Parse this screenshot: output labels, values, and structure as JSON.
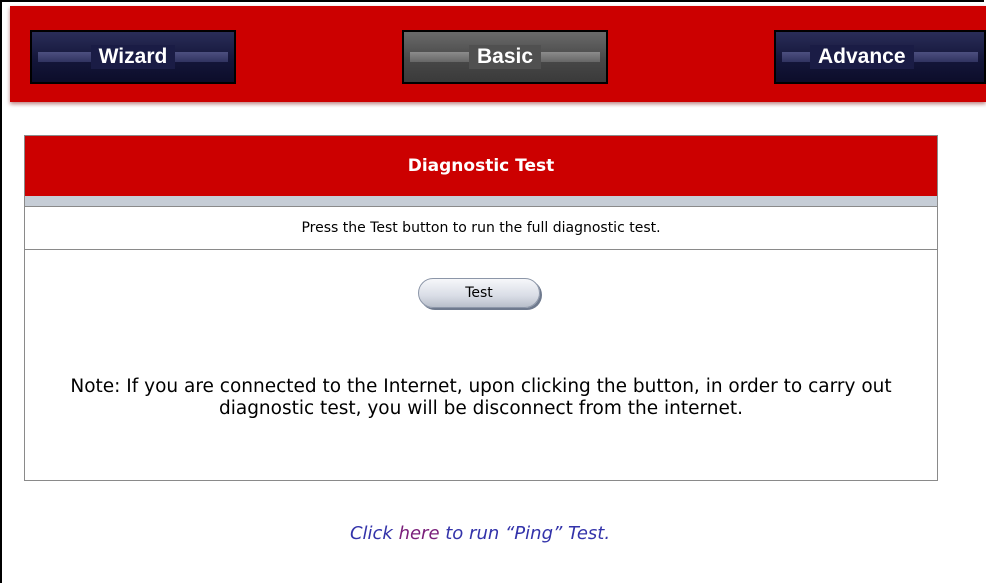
{
  "nav": {
    "wizard_label": "Wizard",
    "basic_label": "Basic",
    "advance_label": "Advance"
  },
  "panel": {
    "title": "Diagnostic Test",
    "instruction": "Press the Test button to run the full diagnostic test.",
    "test_button_label": "Test",
    "note": "Note: If you are connected to the Internet, upon clicking the button, in order to carry out diagnostic test, you will be disconnect from the internet."
  },
  "ping": {
    "prefix": "Click ",
    "link_label": "here",
    "suffix": " to run “Ping” Test."
  },
  "colors": {
    "header_red": "#cc0000",
    "nav_dark_blue": "#14163a",
    "nav_active_gray": "#484848",
    "link_purple": "#7a1f7a",
    "ping_text_blue": "#3333aa"
  }
}
